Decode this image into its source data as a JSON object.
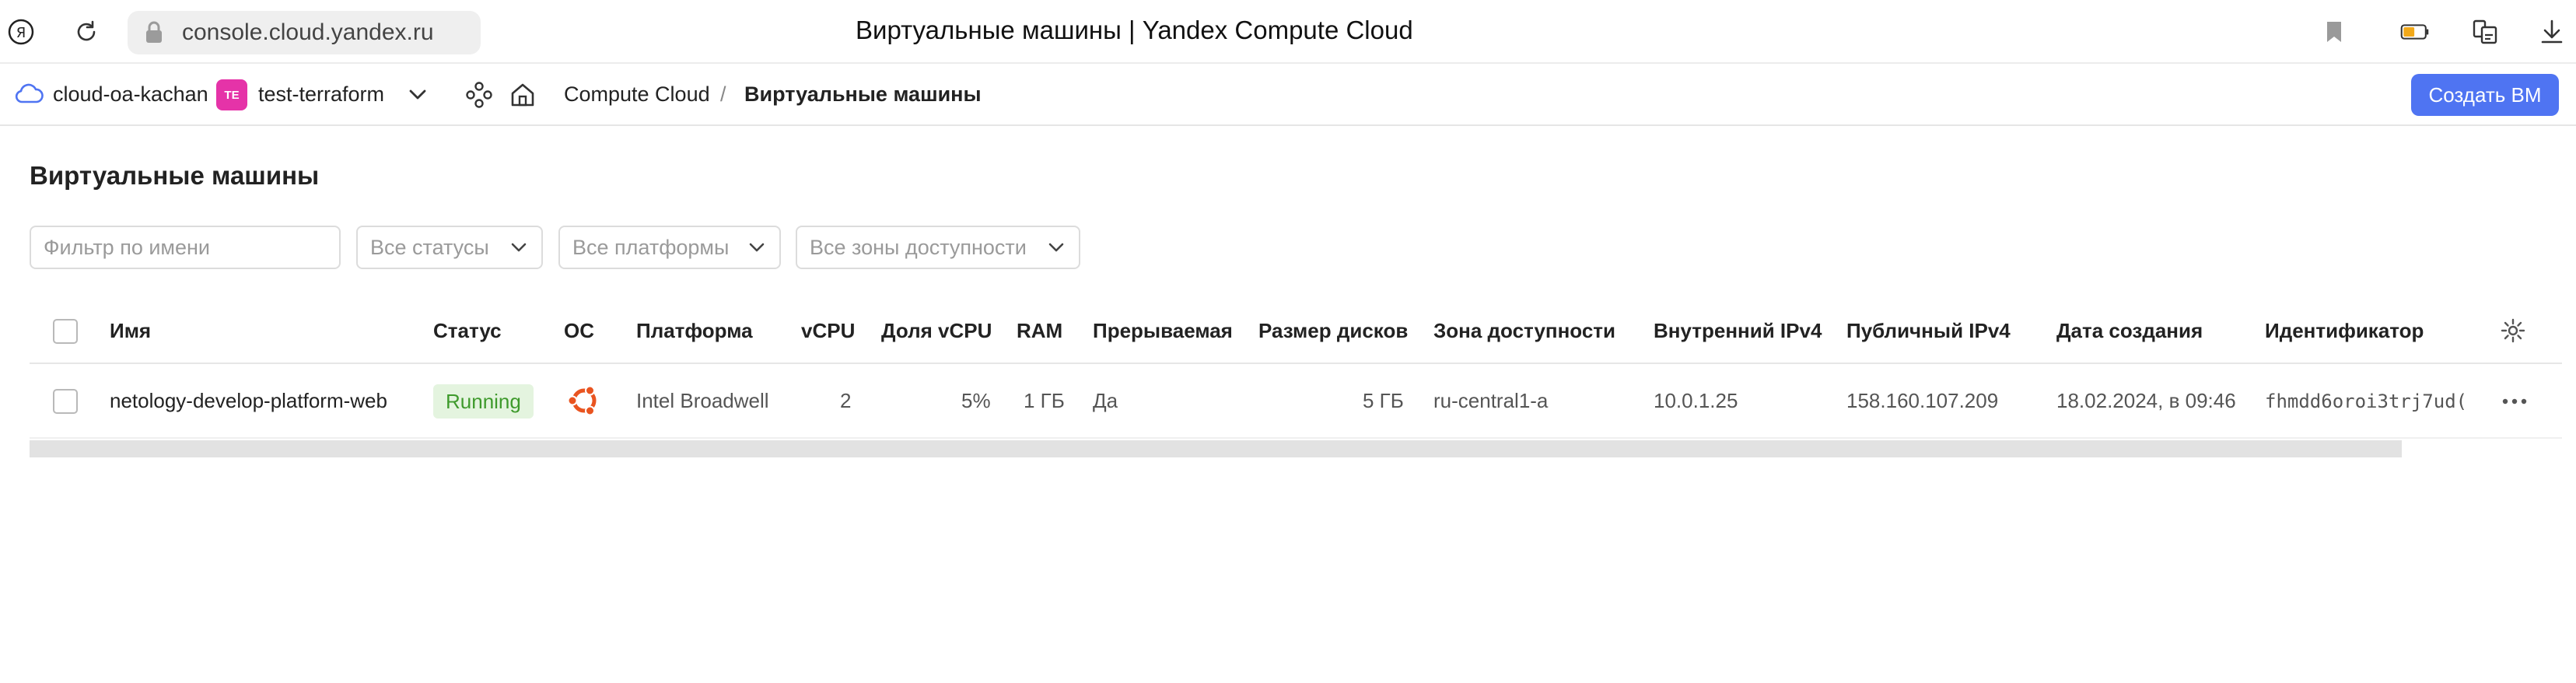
{
  "browser": {
    "url": "console.cloud.yandex.ru",
    "title": "Виртуальные машины | Yandex Compute Cloud",
    "logo_glyph": "Я"
  },
  "nav": {
    "cloud": "cloud-oa-kachan",
    "folder_avatar": "TE",
    "folder": "test-terraform",
    "breadcrumb_service": "Compute Cloud",
    "breadcrumb_sep": "/",
    "breadcrumb_current": "Виртуальные машины",
    "create_button": "Создать ВМ"
  },
  "page": {
    "heading": "Виртуальные машины"
  },
  "filters": {
    "name_placeholder": "Фильтр по имени",
    "status": "Все статусы",
    "platform": "Все платформы",
    "zone": "Все зоны доступности"
  },
  "table": {
    "columns": [
      "Имя",
      "Статус",
      "ОС",
      "Платформа",
      "vCPU",
      "Доля vCPU",
      "RAM",
      "Прерываемая",
      "Размер дисков",
      "Зона доступности",
      "Внутренний IPv4",
      "Публичный IPv4",
      "Дата создания",
      "Идентификатор"
    ],
    "rows": [
      {
        "name": "netology-develop-platform-web",
        "status": "Running",
        "os_icon": "ubuntu-icon",
        "platform": "Intel Broadwell",
        "vcpu": "2",
        "vcpu_share": "5%",
        "ram": "1 ГБ",
        "preemptible": "Да",
        "disk_size": "5 ГБ",
        "zone": "ru-central1-a",
        "internal_ip": "10.0.1.25",
        "public_ip": "158.160.107.209",
        "created": "18.02.2024, в 09:46",
        "id": "fhmdd6oroi3trj7ud("
      }
    ]
  },
  "colors": {
    "accent": "#4f74f2",
    "running_bg": "#e4f4df",
    "running_text": "#3e9a2c",
    "avatar": "#e533a8",
    "ubuntu": "#e95420"
  }
}
